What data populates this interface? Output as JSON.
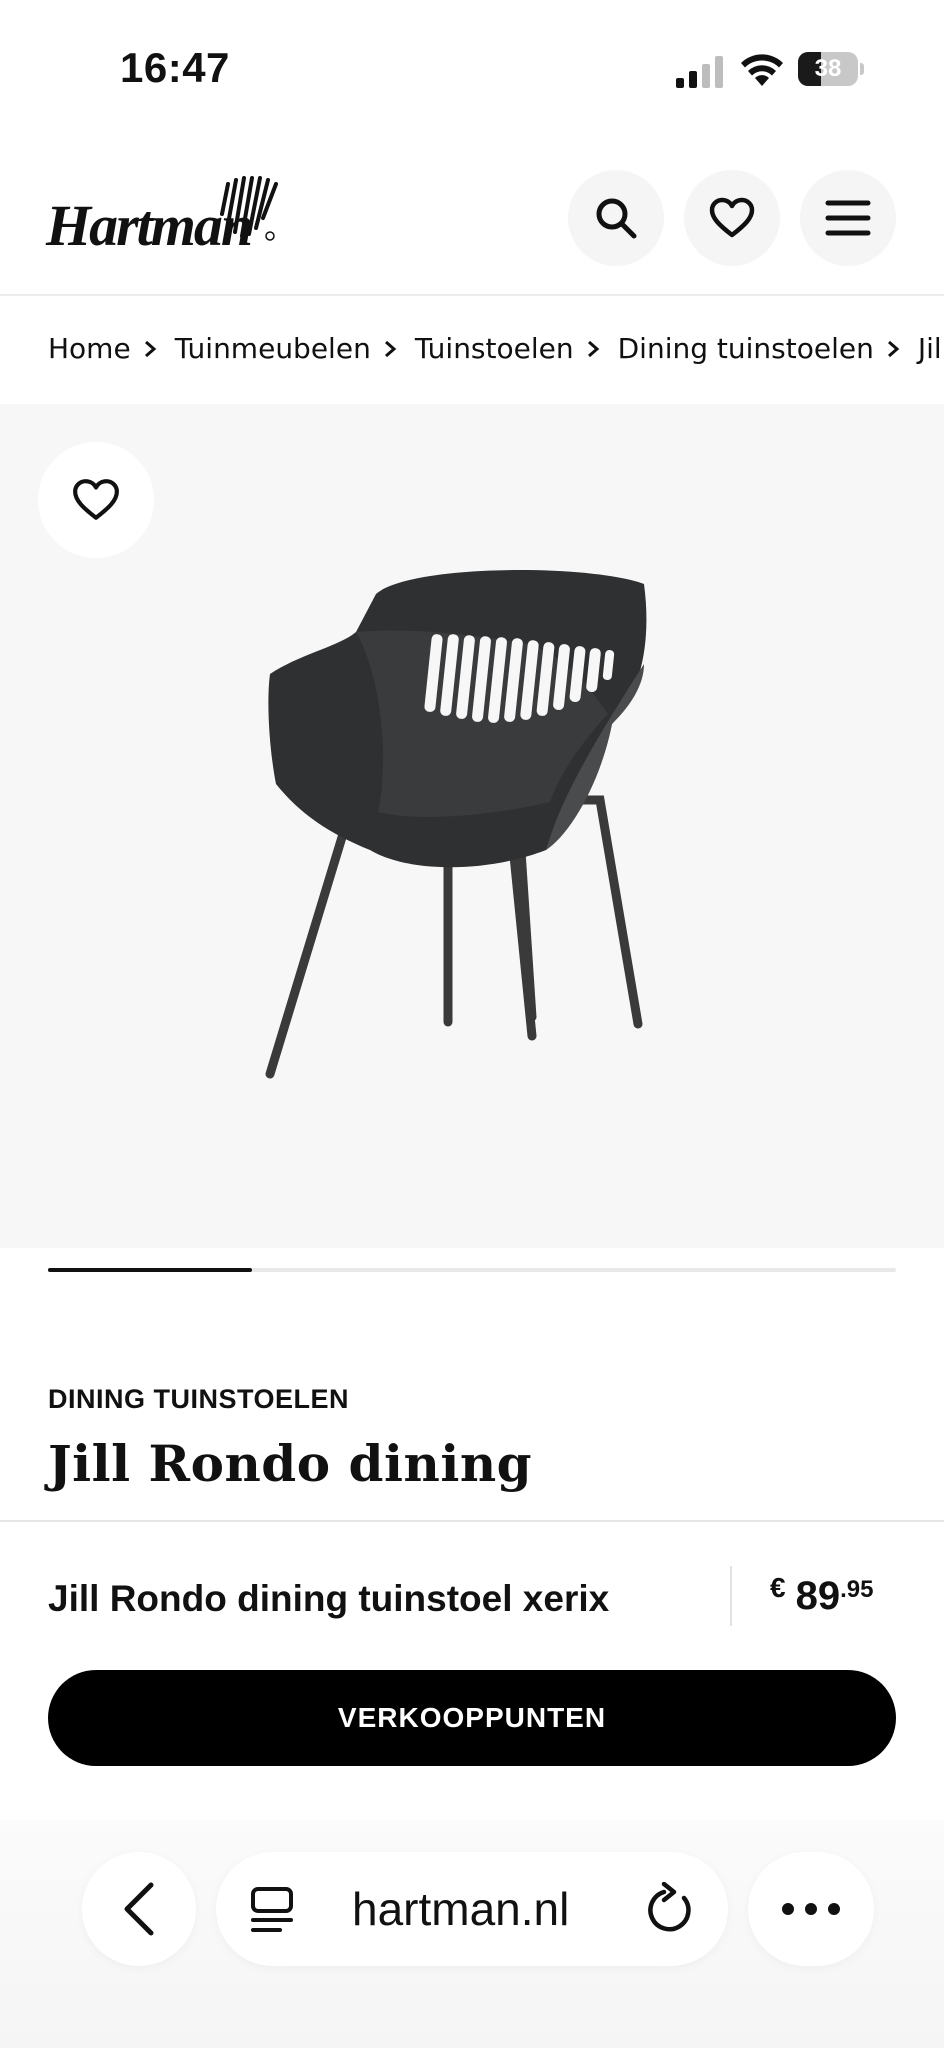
{
  "status_bar": {
    "time": "16:47",
    "battery_level": "38",
    "battery_fraction": 0.38
  },
  "header": {
    "logo_text": "Hartman",
    "icons": [
      "search-icon",
      "heart-icon",
      "menu-icon"
    ]
  },
  "breadcrumb": {
    "items": [
      "Home",
      "Tuinmeubelen",
      "Tuinstoelen",
      "Dining tuinstoelen",
      "Jill Rondo dining"
    ]
  },
  "gallery": {
    "favorite_icon": "heart-icon",
    "image_subject": "chair",
    "progress_fraction": 0.24
  },
  "product": {
    "category": "DINING TUINSTOELEN",
    "title": "Jill Rondo dining"
  },
  "buy_bar": {
    "variant_name": "Jill Rondo dining tuinstoel xerix",
    "price_currency": "€",
    "price_main": "89",
    "price_cents": ".95",
    "cta_label": "VERKOOPPUNTEN"
  },
  "browser": {
    "url": "hartman.nl",
    "icons": [
      "back-icon",
      "reader-icon",
      "reload-icon",
      "more-icon"
    ]
  },
  "colors": {
    "accent": "#000000",
    "gallery_bg": "#f7f7f7",
    "button_bg": "#f5f5f5"
  }
}
